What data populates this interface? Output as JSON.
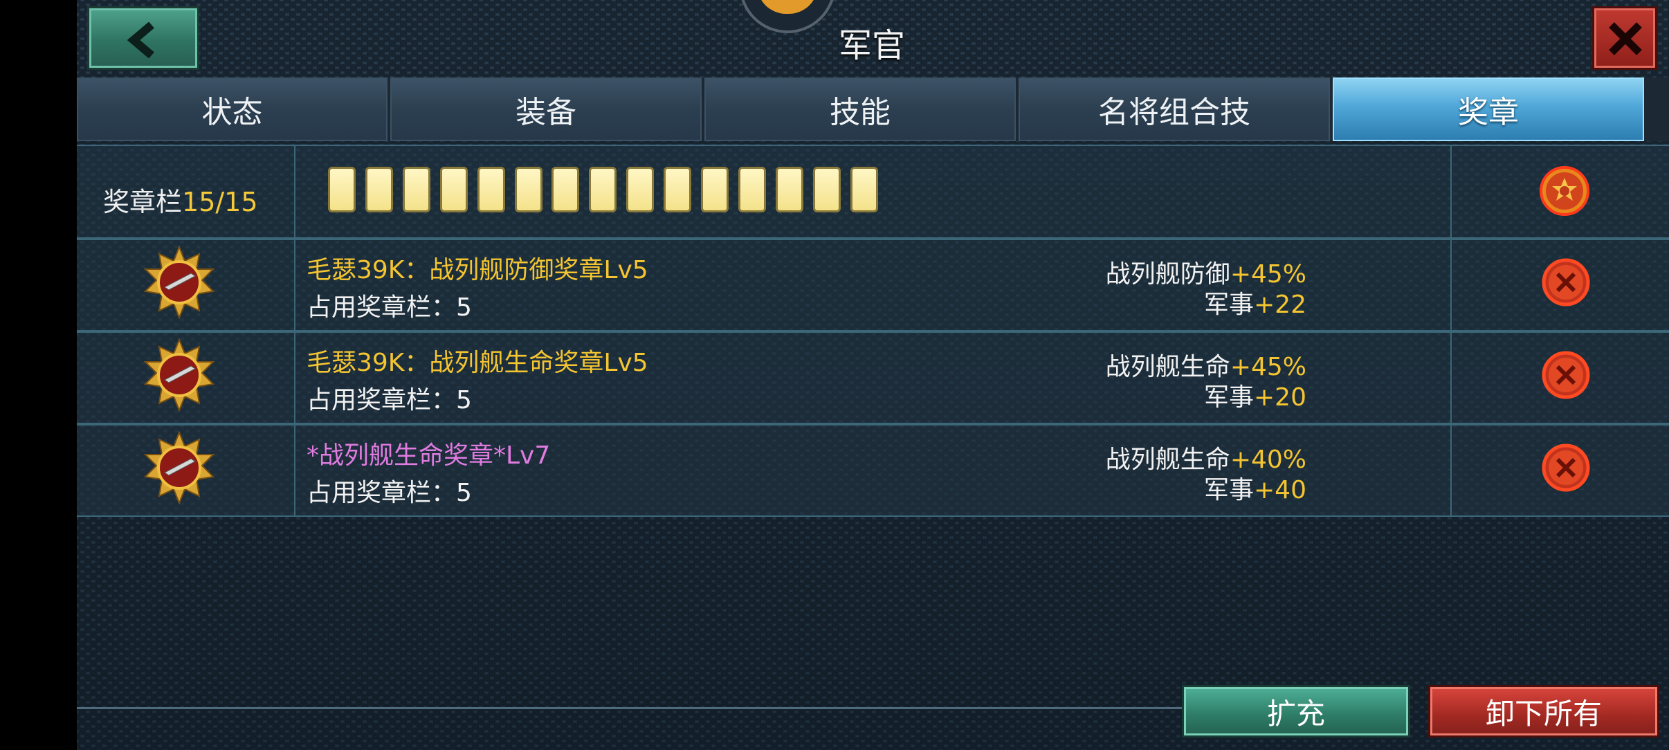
{
  "header": {
    "title": "军官"
  },
  "tabs": [
    {
      "label": "状态"
    },
    {
      "label": "装备"
    },
    {
      "label": "技能"
    },
    {
      "label": "名将组合技"
    },
    {
      "label": "奖章"
    }
  ],
  "active_tab_index": 4,
  "medal_slots": {
    "label": "奖章栏",
    "count": "15/15",
    "filled": 15,
    "total": 15
  },
  "medals": [
    {
      "name": "毛瑟39K：战列舰防御奖章Lv5",
      "name_color": "#f4c531",
      "usage": "占用奖章栏：5",
      "stat1_label": "战列舰防御",
      "stat1_value": "+45%",
      "stat2_label": "军事",
      "stat2_value": "+22"
    },
    {
      "name": "毛瑟39K：战列舰生命奖章Lv5",
      "name_color": "#f4c531",
      "usage": "占用奖章栏：5",
      "stat1_label": "战列舰生命",
      "stat1_value": "+45%",
      "stat2_label": "军事",
      "stat2_value": "+20"
    },
    {
      "name": "*战列舰生命奖章*Lv7",
      "name_color": "#e07be0",
      "usage": "占用奖章栏：5",
      "stat1_label": "战列舰生命",
      "stat1_value": "+40%",
      "stat2_label": "军事",
      "stat2_value": "+40"
    }
  ],
  "buttons": {
    "expand": "扩充",
    "unload_all": "卸下所有"
  },
  "icons": {
    "back": "chevron-left-icon",
    "close": "close-icon",
    "medal": "medal-icon",
    "remove": "remove-circle-icon",
    "badge": "medal-badge-icon"
  }
}
